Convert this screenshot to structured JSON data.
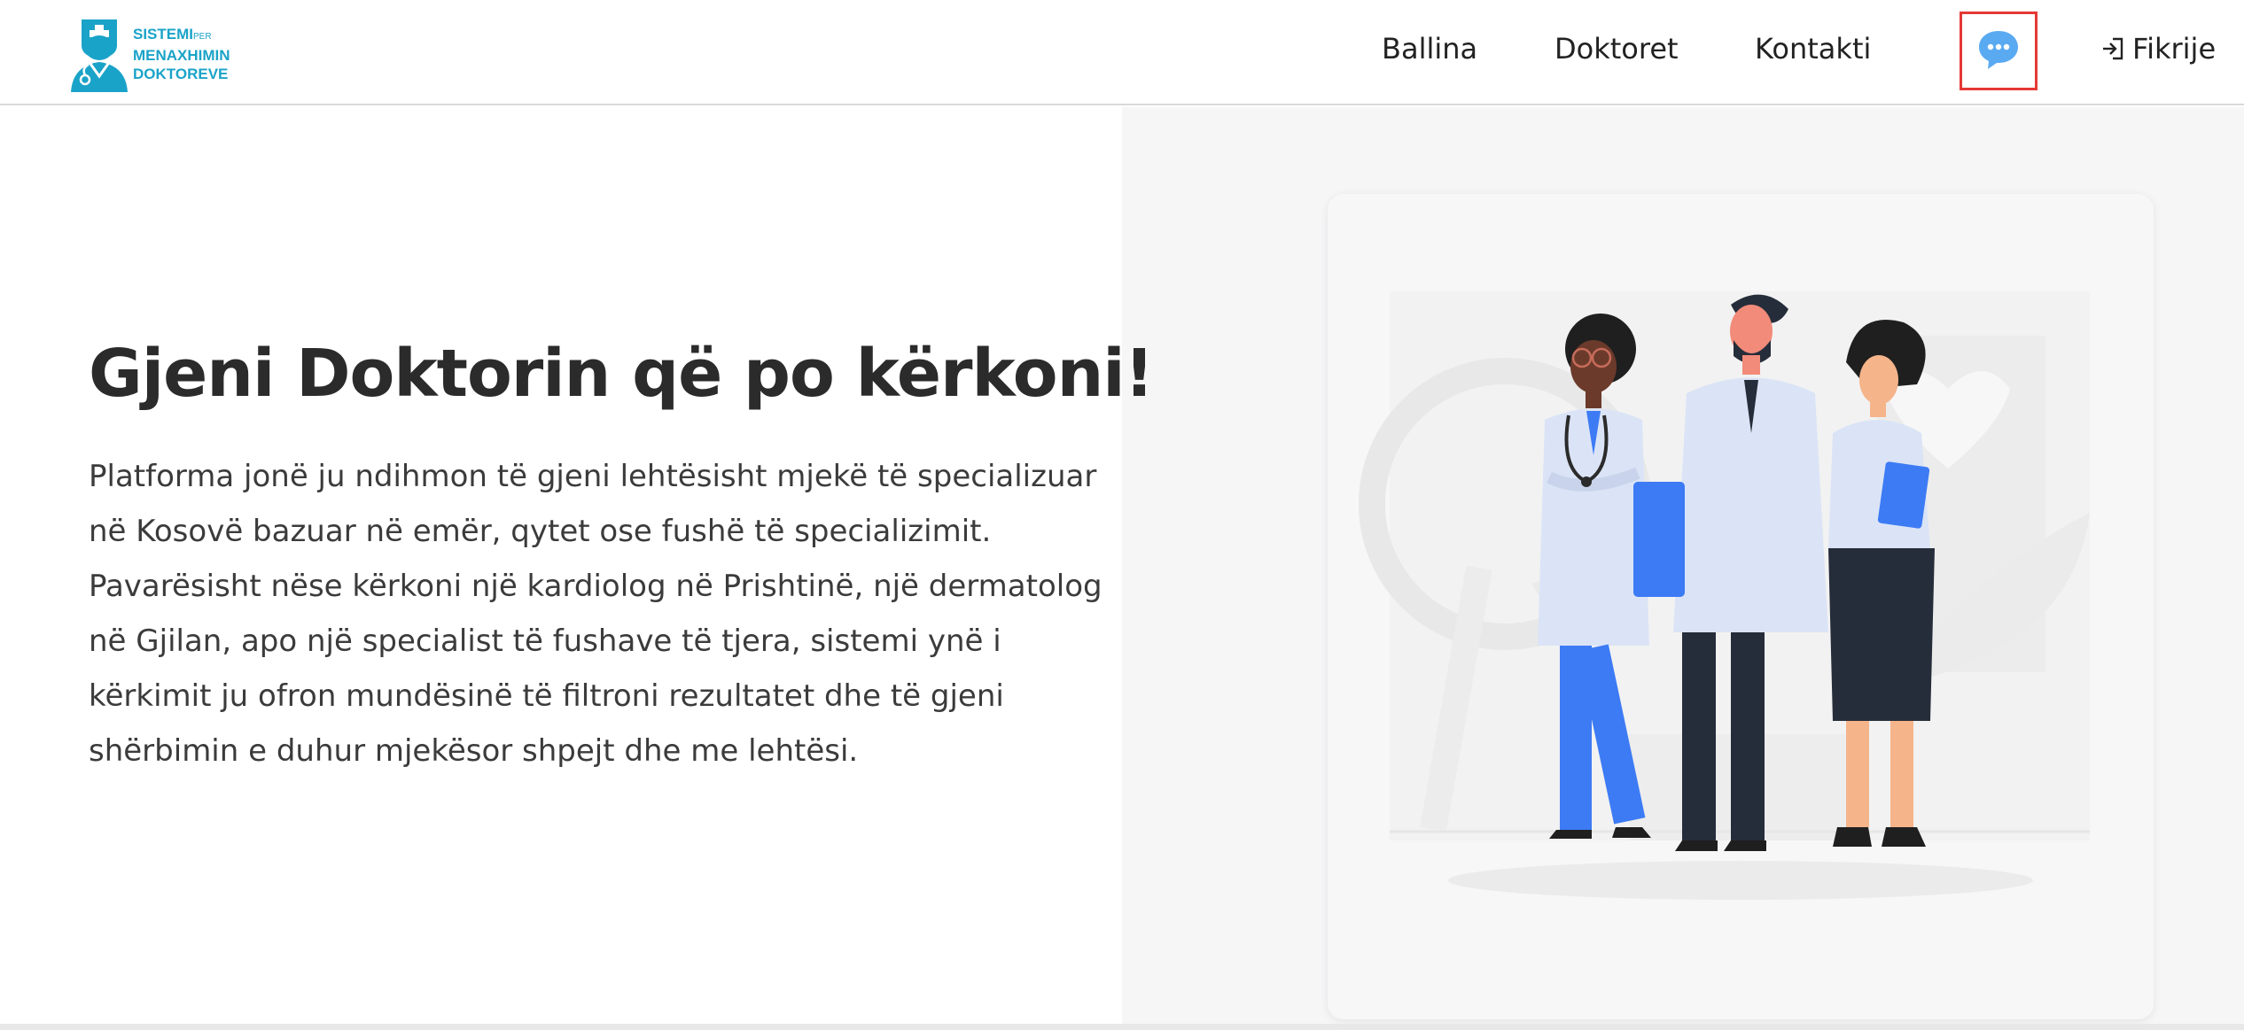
{
  "logo": {
    "line1": "SISTEMI",
    "line1_small": "PER",
    "line2": "MENAXHIMIN",
    "line3": "DOKTOREVE",
    "icon": "doctor-logo-icon"
  },
  "nav": {
    "home": "Ballina",
    "doctors": "Doktoret",
    "contact": "Kontakti",
    "chat_icon": "chat-bubble-icon",
    "logout_icon": "sign-out-icon",
    "logout": "Fikrije"
  },
  "hero": {
    "title": "Gjeni Doktorin që po kërkoni!",
    "paragraph": "Platforma jonë ju ndihmon të gjeni lehtësisht mjekë të specializuar në Kosovë bazuar në emër, qytet ose fushë të specializimit. Pavarësisht nëse kërkoni një kardiolog në Prishtinë, një dermatolog në Gjilan, apo një specialist të fushave të tjera, sistemi ynë i kërkimit ju ofron mundësinë të filtroni rezultatet dhe të gjeni shërbimin e duhur mjekësor shpejt dhe me lehtësi.",
    "illustration": "doctors-illustration"
  },
  "colors": {
    "brand": "#1aa3c8",
    "highlight_border": "#e53935",
    "chat_bubble": "#5aaaf2",
    "accent_blue": "#3d7bf5"
  }
}
